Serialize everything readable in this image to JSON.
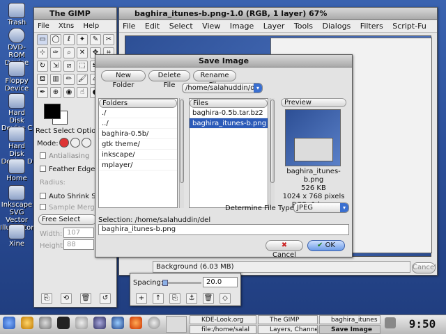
{
  "desktop": {
    "icons": [
      {
        "label": "Trash",
        "name": "trash-icon"
      },
      {
        "label": "DVD-ROM Device",
        "name": "dvd-rom-icon"
      },
      {
        "label": "Floppy Device",
        "name": "floppy-icon"
      },
      {
        "label": "Hard Disk Device C",
        "name": "hard-disk-icon"
      },
      {
        "label": "Hard Disk Device D",
        "name": "hard-disk-icon"
      },
      {
        "label": "Home",
        "name": "home-icon"
      },
      {
        "label": "Inkscape SVG Vector Illustrator",
        "name": "inkscape-icon"
      },
      {
        "label": "Xine",
        "name": "xine-icon"
      }
    ]
  },
  "gimp_toolbox": {
    "title": "The GIMP",
    "menu": [
      "File",
      "Xtns",
      "Help"
    ],
    "tool_options_title": "Rect Select Option",
    "mode_label": "Mode:",
    "antialiasing": "Antialiasing",
    "feather": "Feather Edges",
    "radius": "Radius:",
    "auto_shrink": "Auto Shrink Se",
    "sample_merged": "Sample Merge",
    "free_select": "Free Select",
    "width_label": "Width:",
    "width_value": "107",
    "height_label": "Height:",
    "height_value": "88"
  },
  "image_window": {
    "title": "baghira_itunes-b.png-1.0 (RGB, 1 layer) 67%",
    "menu": [
      "File",
      "Edit",
      "Select",
      "View",
      "Image",
      "Layer",
      "Tools",
      "Dialogs",
      "Filters",
      "Script-Fu"
    ],
    "status": "Background (6.03 MB)",
    "cancel": "Cancel"
  },
  "layers_window": {
    "spacing_label": "Spacing:",
    "spacing_value": "20.0"
  },
  "save_dialog": {
    "title": "Save Image",
    "new_folder": "New Folder",
    "delete_file": "Delete File",
    "rename_file": "Rename File",
    "path": "/home/salahuddin/del",
    "folders_header": "Folders",
    "folders": [
      "./",
      "../",
      "baghira-0.5b/",
      "gtk theme/",
      "inkscape/",
      "mplayer/"
    ],
    "files_header": "Files",
    "files": [
      "baghira-0.5b.tar.bz2",
      "baghira_itunes-b.png"
    ],
    "selected_file_index": 1,
    "preview_header": "Preview",
    "preview_name": "baghira_itunes-b.png",
    "preview_size": "526 KB",
    "preview_dims": "1024 x 768 pixels",
    "preview_mode": "RGB, 1 layer",
    "determine_label": "Determine File Type:",
    "file_type": "JPEG",
    "selection_label": "Selection: /home/salahuddin/del",
    "selection_value": "baghira_itunes-b.png",
    "cancel": "Cancel",
    "ok": "OK"
  },
  "taskbar": {
    "tasks": [
      "KDE-Look.org",
      "The GIMP",
      "baghira_itunes",
      "file:/home/salal",
      "Layers, Channe",
      "Save Image"
    ],
    "clock": "9:50"
  }
}
